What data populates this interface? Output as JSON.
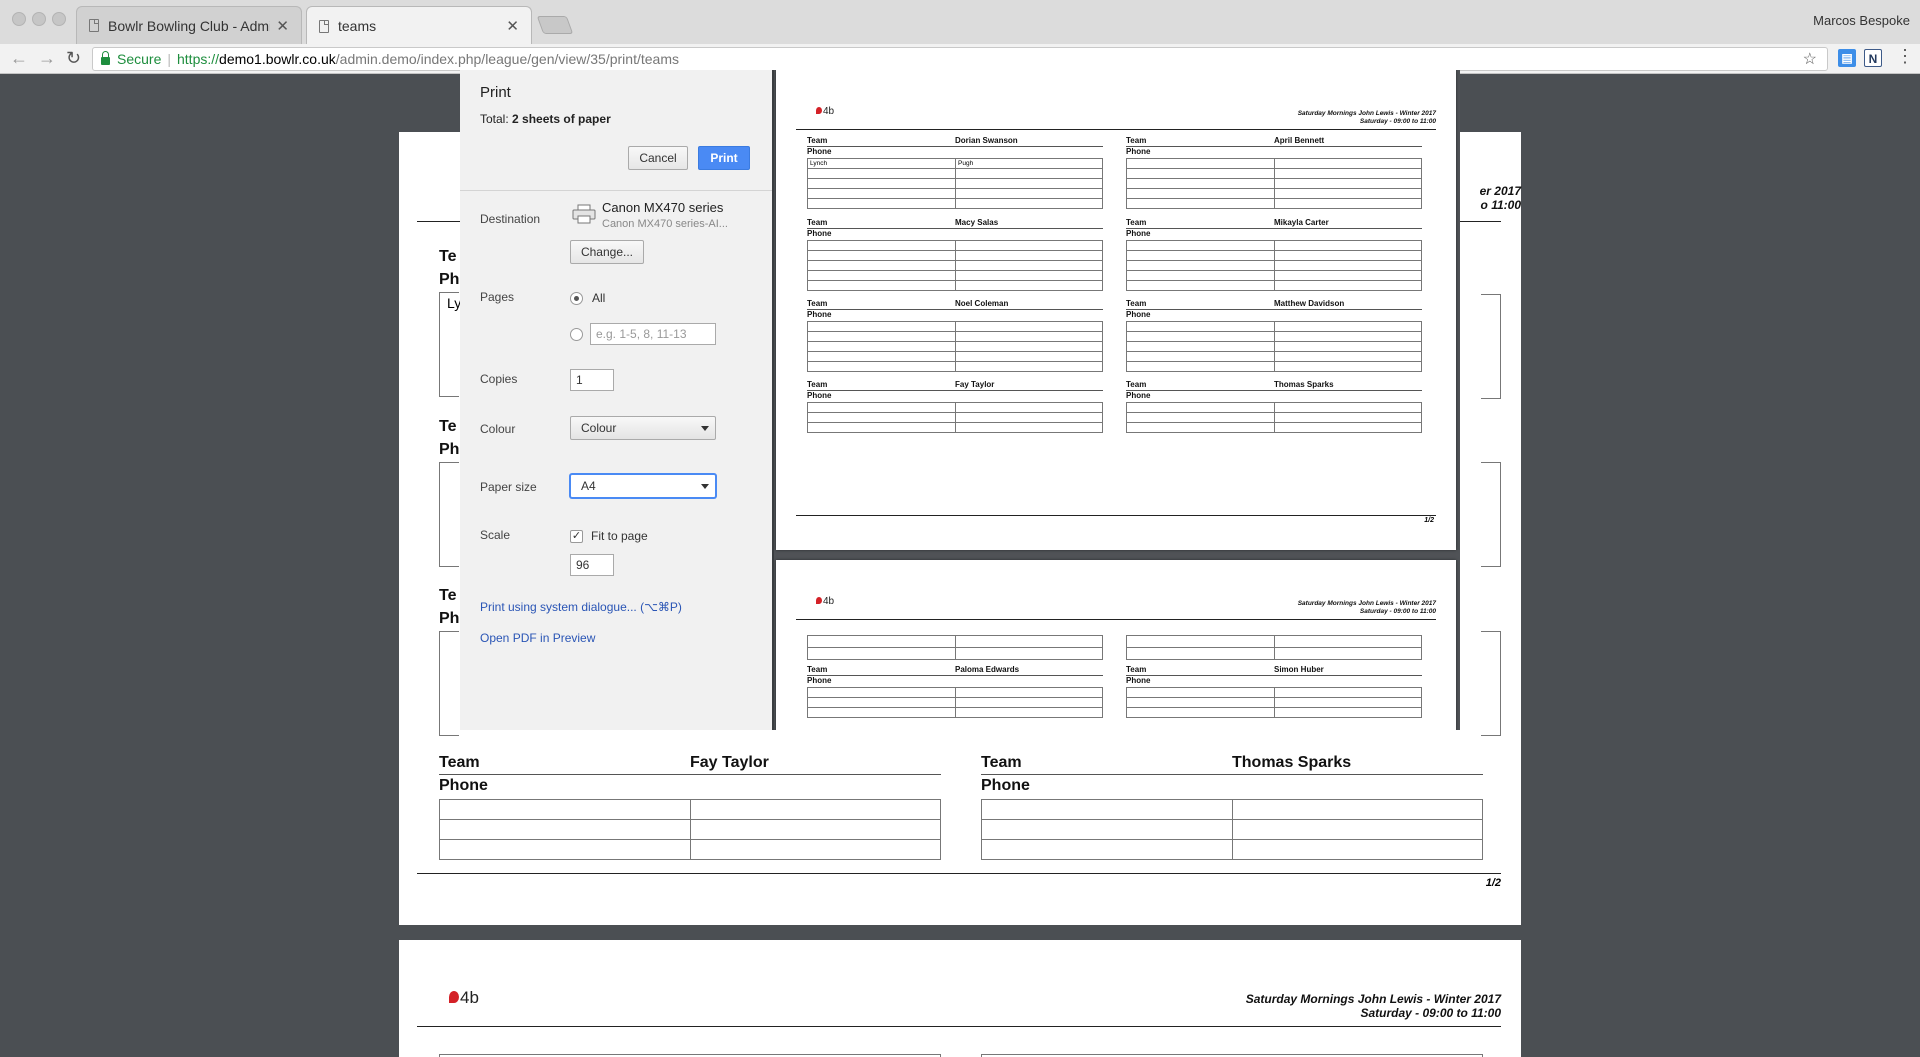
{
  "browser": {
    "tabs": [
      {
        "title": "Bowlr Bowling Club - Administ",
        "close": "✕"
      },
      {
        "title": "teams",
        "close": "✕"
      }
    ],
    "user": "Marcos Bespoke",
    "address": {
      "secure_label": "Secure",
      "scheme": "https://",
      "host": "demo1.bowlr.co.uk",
      "path": "/admin.demo/index.php/league/gen/view/35/print/teams"
    }
  },
  "dialog": {
    "title": "Print",
    "total_label": "Total:",
    "total_value": "2 sheets of paper",
    "cancel_label": "Cancel",
    "print_label": "Print",
    "destination": {
      "label": "Destination",
      "printer_name": "Canon MX470 series",
      "printer_sub": "Canon MX470 series-AI...",
      "change_label": "Change..."
    },
    "pages": {
      "label": "Pages",
      "all_label": "All",
      "custom_placeholder": "e.g. 1-5, 8, 11-13"
    },
    "copies": {
      "label": "Copies",
      "value": "1"
    },
    "colour": {
      "label": "Colour",
      "value": "Colour"
    },
    "paper_size": {
      "label": "Paper size",
      "value": "A4"
    },
    "scale": {
      "label": "Scale",
      "fit_label": "Fit to page",
      "value": "96"
    },
    "system_dialog_link": "Print using system dialogue... (⌥⌘P)",
    "open_pdf_link": "Open PDF in Preview"
  },
  "document": {
    "logo_text": "4b",
    "league": "Saturday Mornings John Lewis - Winter 2017",
    "schedule": "Saturday - 09:00 to 11:00",
    "team_label": "Team",
    "phone_label": "Phone",
    "page1_number": "1/2",
    "page1_cards": [
      {
        "captain": "Dorian Swanson",
        "rows": [
          [
            "Lynch",
            "Pugh"
          ],
          [
            "",
            ""
          ],
          [
            "",
            ""
          ],
          [
            "",
            ""
          ],
          [
            "",
            ""
          ]
        ]
      },
      {
        "captain": "April Bennett",
        "rows": [
          [
            "",
            ""
          ],
          [
            "",
            ""
          ],
          [
            "",
            ""
          ],
          [
            "",
            ""
          ],
          [
            "",
            ""
          ]
        ]
      },
      {
        "captain": "Macy Salas",
        "rows": [
          [
            "",
            ""
          ],
          [
            "",
            ""
          ],
          [
            "",
            ""
          ],
          [
            "",
            ""
          ],
          [
            "",
            ""
          ]
        ]
      },
      {
        "captain": "Mikayla Carter",
        "rows": [
          [
            "",
            ""
          ],
          [
            "",
            ""
          ],
          [
            "",
            ""
          ],
          [
            "",
            ""
          ],
          [
            "",
            ""
          ]
        ]
      },
      {
        "captain": "Noel Coleman",
        "rows": [
          [
            "",
            ""
          ],
          [
            "",
            ""
          ],
          [
            "",
            ""
          ],
          [
            "",
            ""
          ],
          [
            "",
            ""
          ]
        ]
      },
      {
        "captain": "Matthew Davidson",
        "rows": [
          [
            "",
            ""
          ],
          [
            "",
            ""
          ],
          [
            "",
            ""
          ],
          [
            "",
            ""
          ],
          [
            "",
            ""
          ]
        ]
      },
      {
        "captain": "Fay Taylor",
        "rows": [
          [
            "",
            ""
          ],
          [
            "",
            ""
          ],
          [
            "",
            ""
          ]
        ]
      },
      {
        "captain": "Thomas Sparks",
        "rows": [
          [
            "",
            ""
          ],
          [
            "",
            ""
          ],
          [
            "",
            ""
          ]
        ]
      }
    ],
    "page2_cards": [
      {
        "captain": "Paloma Edwards"
      },
      {
        "captain": "Simon Huber"
      }
    ],
    "bg_partial": {
      "team": "Te",
      "phone": "Ph",
      "first_cell": "Ly",
      "header_tail_1": "er 2017",
      "header_tail_2": "o 11:00"
    }
  }
}
